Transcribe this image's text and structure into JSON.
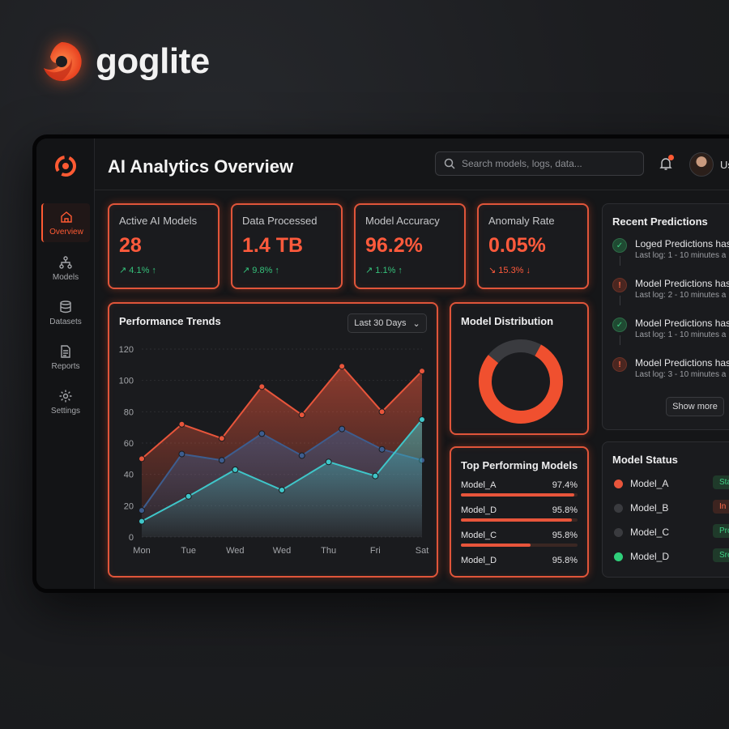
{
  "brand": {
    "name": "goglite"
  },
  "window": {
    "title": "AI Analytics Overview",
    "search_placeholder": "Search models, logs, data...",
    "user_label": "Us"
  },
  "sidebar": {
    "items": [
      {
        "label": "Overview",
        "icon": "home-icon"
      },
      {
        "label": "Models",
        "icon": "hierarchy-icon"
      },
      {
        "label": "Datasets",
        "icon": "database-icon"
      },
      {
        "label": "Reports",
        "icon": "document-icon"
      },
      {
        "label": "Settings",
        "icon": "gear-icon"
      }
    ]
  },
  "kpis": [
    {
      "label": "Active AI Models",
      "value": "28",
      "delta": "↗ 4.1% ↑",
      "trend": "up"
    },
    {
      "label": "Data Processed",
      "value": "1.4 TB",
      "delta": "↗ 9.8% ↑",
      "trend": "up"
    },
    {
      "label": "Model Accuracy",
      "value": "96.2%",
      "delta": "↗ 1.1% ↑",
      "trend": "up"
    },
    {
      "label": "Anomaly Rate",
      "value": "0.05%",
      "delta": "↘ 15.3% ↓",
      "trend": "down"
    }
  ],
  "performance": {
    "title": "Performance Trends",
    "range": "Last 30 Days",
    "chart_data": {
      "type": "area",
      "x": [
        "Mon",
        "Tue",
        "Wed",
        "Wed",
        "Thu",
        "Fri",
        "Sat"
      ],
      "series": [
        {
          "name": "",
          "color": "#e8553b",
          "values": [
            50,
            72,
            63,
            96,
            78,
            109,
            80,
            106
          ]
        },
        {
          "name": "",
          "color": "#3d5d8f",
          "values": [
            17,
            53,
            49,
            66,
            52,
            69,
            56,
            49
          ]
        },
        {
          "name": "",
          "color": "#3fc6c9",
          "values": [
            10,
            26,
            43,
            30,
            48,
            39,
            75
          ]
        }
      ],
      "yticks": [
        "0",
        "20",
        "40",
        "60",
        "80",
        "100",
        "120"
      ],
      "ylim": [
        0,
        120
      ]
    }
  },
  "distribution": {
    "title": "Model Distribution",
    "chart_data": {
      "type": "pie",
      "values": [
        78,
        22
      ],
      "colors": [
        "#f0502f",
        "#3a3b3f"
      ]
    }
  },
  "top_models": {
    "title": "Top Performing Models",
    "items": [
      {
        "name": "Model_A",
        "value": "97.4%",
        "fill": 0.97
      },
      {
        "name": "Model_D",
        "value": "95.8%",
        "fill": 0.95
      },
      {
        "name": "Model_C",
        "value": "95.8%",
        "fill": 0.6
      },
      {
        "name": "Model_D",
        "value": "95.8%",
        "fill": null
      }
    ]
  },
  "recent_predictions": {
    "title": "Recent Predictions",
    "items": [
      {
        "title": "Loged Predictions has",
        "sub": "Last log: 1 - 10 minutes a",
        "status": "ok",
        "icon": "check-icon"
      },
      {
        "title": "Model Predictions has",
        "sub": "Last log: 2 - 10 minutes a",
        "status": "err",
        "icon": "error-icon"
      },
      {
        "title": "Model Predictions has",
        "sub": "Last log: 1 - 10 minutes a",
        "status": "ok",
        "icon": "check-icon"
      },
      {
        "title": "Model Predictions has",
        "sub": "Last log: 3 - 10 minutes a",
        "status": "err",
        "icon": "error-icon"
      }
    ],
    "show_more": "Show more"
  },
  "model_status": {
    "title": "Model Status",
    "items": [
      {
        "name": "Model_A",
        "badge": "Sta",
        "dot": "#e8553b",
        "badge_bg": "#1f3a2a",
        "badge_color": "#3fd184"
      },
      {
        "name": "Model_B",
        "badge": "In",
        "dot": "#3a3b3f",
        "badge_bg": "#3d2420",
        "badge_color": "#ff6a4a"
      },
      {
        "name": "Model_C",
        "badge": "Pro",
        "dot": "#3a3b3f",
        "badge_bg": "#1f3a2a",
        "badge_color": "#3fd184"
      },
      {
        "name": "Model_D",
        "badge": "Sre",
        "dot": "#2fcf7a",
        "badge_bg": "#1f3a2a",
        "badge_color": "#3fd184"
      }
    ]
  }
}
